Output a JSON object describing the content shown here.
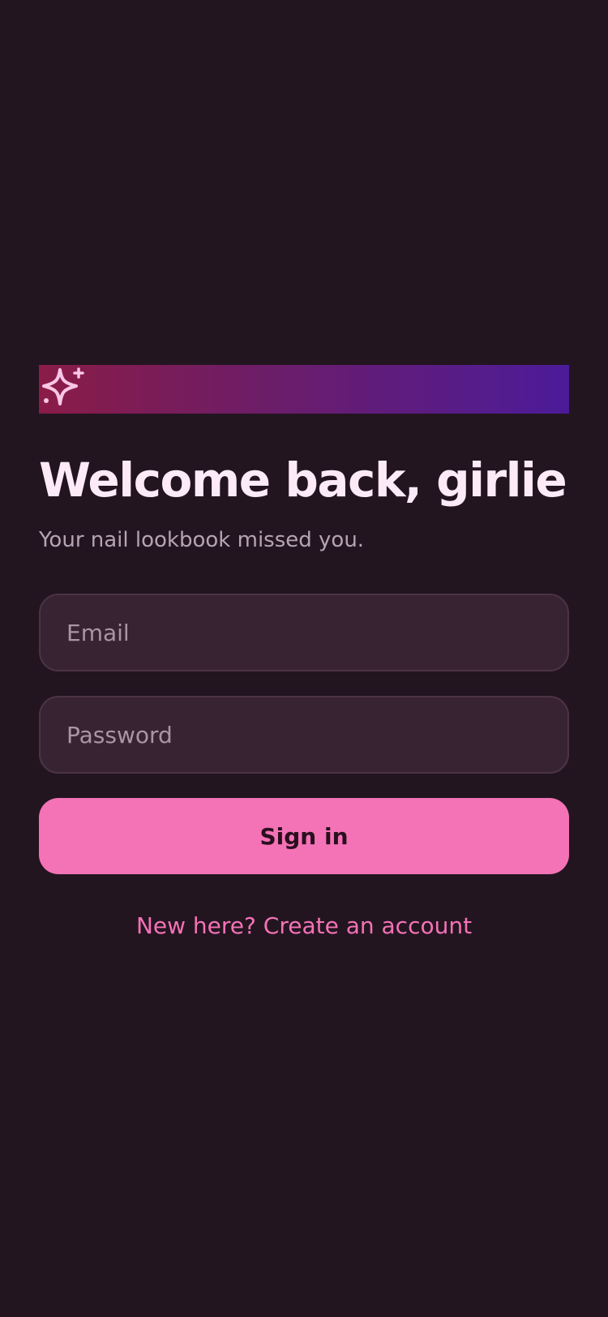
{
  "header": {
    "banner_icon": "sparkles-icon",
    "title": "Welcome back, girlie",
    "subtitle": "Your nail lookbook missed you."
  },
  "form": {
    "email_placeholder": "Email",
    "email_value": "",
    "password_placeholder": "Password",
    "password_value": "",
    "signin_label": "Sign in"
  },
  "footer": {
    "create_account_link": "New here? Create an account"
  },
  "colors": {
    "background": "#231520",
    "accent_pink": "#f472b6",
    "field_bg": "#382333",
    "banner_gradient_start": "#8a1c47",
    "banner_gradient_end": "#4c1b99"
  }
}
